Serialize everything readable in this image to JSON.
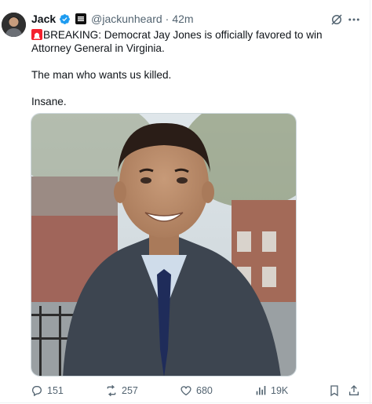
{
  "tweet": {
    "author_name": "Jack",
    "handle": "@jackunheard",
    "separator": "·",
    "time": "42m",
    "lines": [
      "BREAKING: Democrat Jay Jones is officially favored to win Attorney General in Virginia.",
      "The man who wants us killed.",
      "Insane."
    ]
  },
  "actions": {
    "replies": "151",
    "reposts": "257",
    "likes": "680",
    "views": "19K"
  },
  "colors": {
    "text": "#0f1419",
    "muted": "#536471",
    "verified": "#1d9bf0",
    "siren": "#f4212e"
  },
  "icons": [
    "verified-icon",
    "org-badge-icon",
    "grok-icon",
    "more-icon",
    "siren-icon",
    "reply-icon",
    "repost-icon",
    "like-icon",
    "views-icon",
    "bookmark-icon",
    "share-icon"
  ]
}
